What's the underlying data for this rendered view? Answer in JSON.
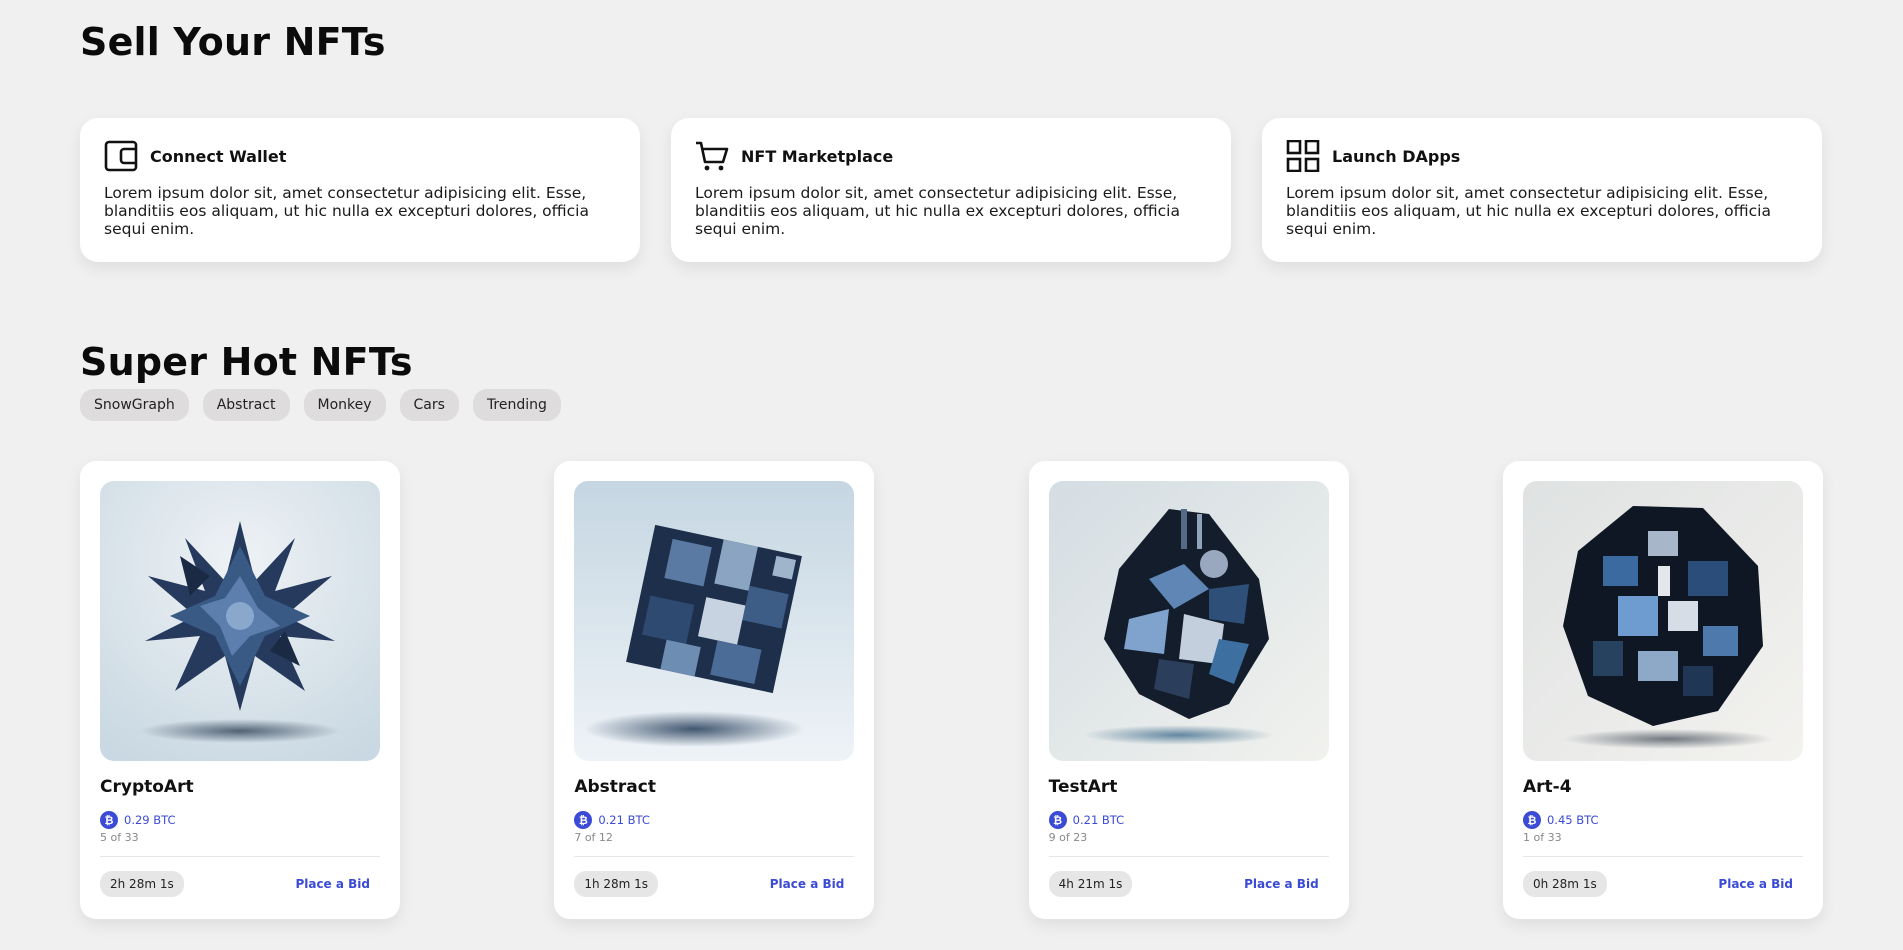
{
  "sell": {
    "title": "Sell Your NFTs",
    "features": [
      {
        "icon": "wallet-icon",
        "title": "Connect Wallet",
        "text": "Lorem ipsum dolor sit, amet consectetur adipisicing elit. Esse, blanditiis eos aliquam, ut hic nulla ex excepturi dolores, officia sequi enim."
      },
      {
        "icon": "cart-icon",
        "title": "NFT Marketplace",
        "text": "Lorem ipsum dolor sit, amet consectetur adipisicing elit. Esse, blanditiis eos aliquam, ut hic nulla ex excepturi dolores, officia sequi enim."
      },
      {
        "icon": "grid-icon",
        "title": "Launch DApps",
        "text": "Lorem ipsum dolor sit, amet consectetur adipisicing elit. Esse, blanditiis eos aliquam, ut hic nulla ex excepturi dolores, officia sequi enim."
      }
    ]
  },
  "hot": {
    "title": "Super Hot NFTs",
    "tags": [
      "SnowGraph",
      "Abstract",
      "Monkey",
      "Cars",
      "Trending"
    ],
    "cards": [
      {
        "title": "CryptoArt",
        "price": "0.29 BTC",
        "edition": "5 of 33",
        "timer": "2h 28m 1s",
        "bid_label": "Place a Bid"
      },
      {
        "title": "Abstract",
        "price": "0.21 BTC",
        "edition": "7 of 12",
        "timer": "1h 28m 1s",
        "bid_label": "Place a Bid"
      },
      {
        "title": "TestArt",
        "price": "0.21 BTC",
        "edition": "9 of 23",
        "timer": "4h 21m 1s",
        "bid_label": "Place a Bid"
      },
      {
        "title": "Art-4",
        "price": "0.45 BTC",
        "edition": "1 of 33",
        "timer": "0h 28m 1s",
        "bid_label": "Place a Bid"
      }
    ]
  },
  "colors": {
    "accent": "#3b4bd6",
    "background": "#f0f0f0"
  },
  "currency_icon": "bitcoin-icon"
}
